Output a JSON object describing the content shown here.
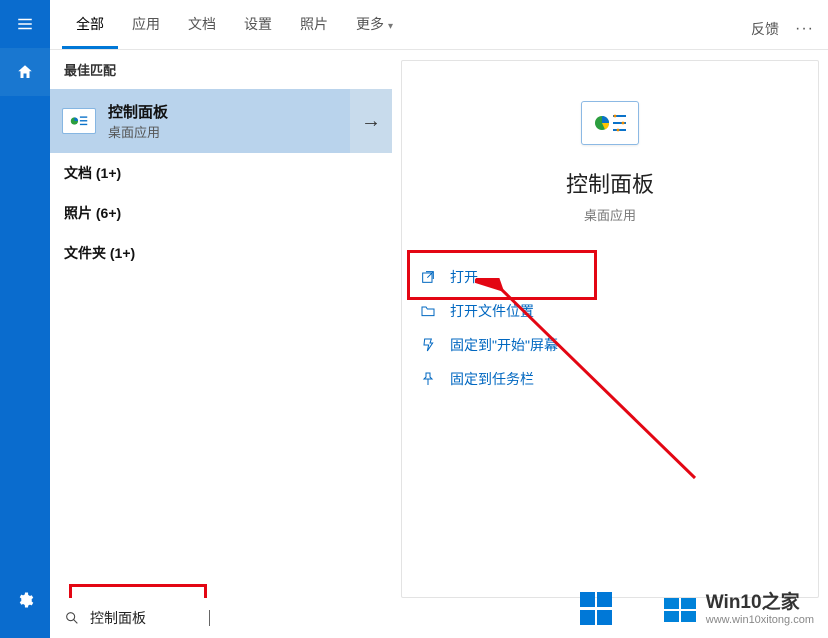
{
  "rail": {
    "menu": "menu",
    "home": "home",
    "settings": "settings"
  },
  "tabs": {
    "all": "全部",
    "apps": "应用",
    "docs": "文档",
    "settings": "设置",
    "photos": "照片",
    "more": "更多"
  },
  "topRight": {
    "feedback": "反馈",
    "more": "···"
  },
  "results": {
    "sectionHeader": "最佳匹配",
    "selected": {
      "title": "控制面板",
      "subtitle": "桌面应用"
    },
    "categories": {
      "docs": "文档 (1+)",
      "photos": "照片 (6+)",
      "folders": "文件夹 (1+)"
    }
  },
  "preview": {
    "title": "控制面板",
    "subtitle": "桌面应用",
    "actions": {
      "open": "打开",
      "openLocation": "打开文件位置",
      "pinStart": "固定到\"开始\"屏幕",
      "pinTaskbar": "固定到任务栏"
    }
  },
  "search": {
    "query": "控制面板"
  },
  "watermark": {
    "brand1": "Win10",
    "brand2": "之家",
    "url": "www.win10xitong.com"
  }
}
